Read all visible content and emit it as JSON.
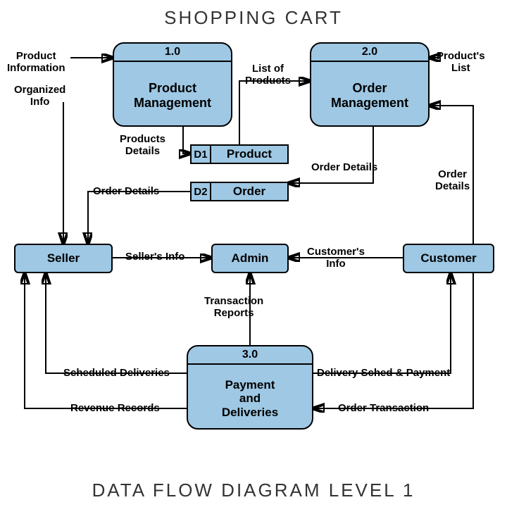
{
  "title": "SHOPPING CART",
  "footer": "DATA FLOW DIAGRAM LEVEL 1",
  "processes": {
    "p1": {
      "id": "1.0",
      "name": "Product\nManagement"
    },
    "p2": {
      "id": "2.0",
      "name": "Order\nManagement"
    },
    "p3": {
      "id": "3.0",
      "name": "Payment\nand\nDeliveries"
    }
  },
  "entities": {
    "seller": "Seller",
    "admin": "Admin",
    "customer": "Customer"
  },
  "datastores": {
    "d1": {
      "id": "D1",
      "name": "Product"
    },
    "d2": {
      "id": "D2",
      "name": "Order"
    }
  },
  "flows": {
    "product_information": "Product\nInformation",
    "organized_info": "Organized\nInfo",
    "products_details": "Products\nDetails",
    "list_of_products": "List of\nProducts",
    "products_list": "Product's\nList",
    "order_details_ds": "Order Details",
    "order_details_p2": "Order Details",
    "order_details_cust": "Order\nDetails",
    "sellers_info": "Seller's Info",
    "customers_info": "Customer's\nInfo",
    "transaction_reports": "Transaction\nReports",
    "scheduled_deliveries": "Scheduled Deliveries",
    "revenue_records": "Revenue Records",
    "delivery_sched": "Delivery Sched & Payment",
    "order_transaction": "Order Transaction"
  }
}
